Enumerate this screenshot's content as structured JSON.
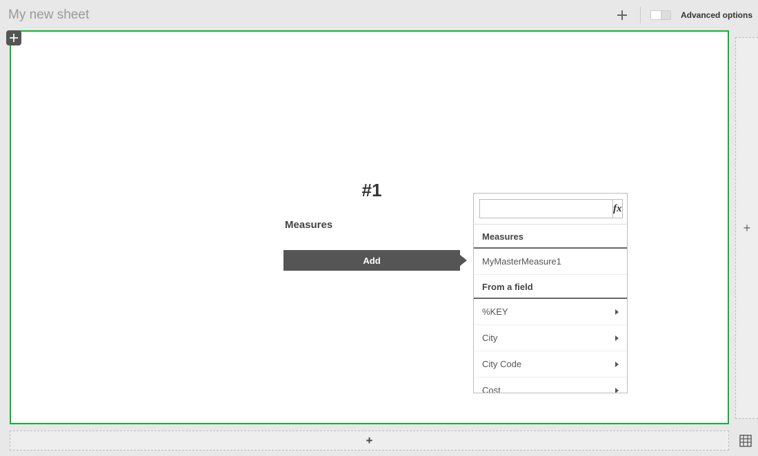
{
  "header": {
    "title": "My new sheet",
    "advanced_options": "Advanced options"
  },
  "config": {
    "kpi_number": "#1",
    "measures_label": "Measures",
    "add_button": "Add"
  },
  "popover": {
    "search_placeholder": "",
    "fx_label": "fx",
    "sections": {
      "measures": {
        "header": "Measures",
        "items": [
          "MyMasterMeasure1"
        ]
      },
      "from_field": {
        "header": "From a field",
        "items": [
          "%KEY",
          "City",
          "City Code",
          "Cost"
        ]
      }
    }
  }
}
